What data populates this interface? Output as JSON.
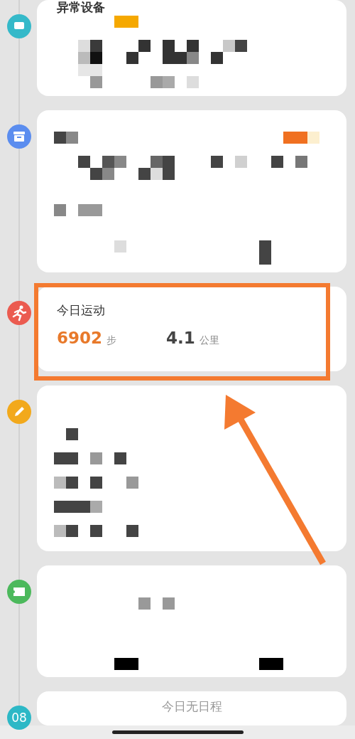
{
  "timeline": [
    {
      "kind": "devices",
      "color": "#35b9c9",
      "title": "异常设备",
      "highlighted": false
    },
    {
      "kind": "parcel",
      "color": "#5b8def",
      "highlighted": false
    },
    {
      "kind": "exercise",
      "color": "#eb5b50",
      "title": "今日运动",
      "steps": "6902",
      "steps_unit": "步",
      "distance": "4.1",
      "distance_unit": "公里",
      "highlighted": true
    },
    {
      "kind": "note",
      "color": "#f2a91c",
      "highlighted": false
    },
    {
      "kind": "ticket",
      "color": "#4cb95c",
      "highlighted": false
    },
    {
      "kind": "schedule",
      "color": "#2db8c6",
      "badge": "08",
      "title": "今日无日程",
      "highlighted": false
    }
  ]
}
